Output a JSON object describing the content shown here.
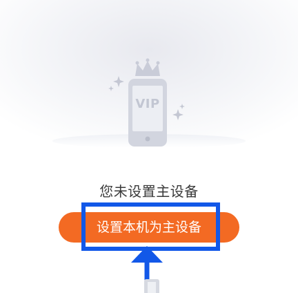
{
  "vip_badge": {
    "text": "VIP"
  },
  "status": {
    "text": "您未设置主设备"
  },
  "primary_button": {
    "label": "设置本机为主设备"
  },
  "colors": {
    "accent": "#f36a23",
    "annotation": "#1258e8",
    "text": "#3a3a3a",
    "illustration": "#c9ccd8"
  },
  "icons": {
    "crown": "crown-icon",
    "phone": "phone-icon",
    "sparkle": "sparkle-icon",
    "arrow": "arrow-up-icon"
  }
}
